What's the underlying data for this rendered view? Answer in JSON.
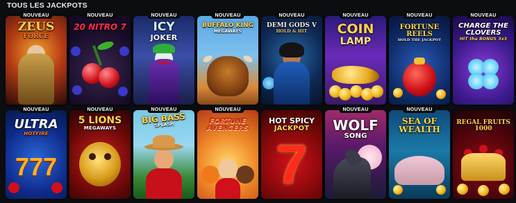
{
  "section": {
    "title": "TOUS LES JACKPOTS"
  },
  "colors": {
    "page_bg": "#0b0d10",
    "badge_bg": "#0a0b0d",
    "title_text": "#e9e9e9"
  },
  "games": [
    {
      "title": "ZEUS",
      "subtitle": "FORCE",
      "badge": "NOUVEAU"
    },
    {
      "title": "20 NITRO 7",
      "subtitle": "",
      "badge": "NOUVEAU"
    },
    {
      "title": "ICY",
      "subtitle": "JOKER",
      "badge": "NOUVEAU"
    },
    {
      "title": "BUFFALO KING",
      "subtitle": "MEGAWAYS",
      "badge": "NOUVEAU"
    },
    {
      "title": "DEMI GODS V",
      "subtitle": "HOLD & HIT",
      "badge": "NOUVEAU"
    },
    {
      "title": "COIN",
      "subtitle": "LAMP",
      "badge": "NOUVEAU"
    },
    {
      "title": "FORTUNE REELS",
      "subtitle": "HOLD THE JACKPOT",
      "badge": "NOUVEAU"
    },
    {
      "title": "CHARGE THE CLOVERS",
      "subtitle": "HIT the BONUS 3x3",
      "badge": "NOUVEAU"
    },
    {
      "title": "ULTRA",
      "subtitle": "HOTFIRE",
      "badge": "NOUVEAU"
    },
    {
      "title": "5 LIONS",
      "subtitle": "MEGAWAYS",
      "badge": "NOUVEAU"
    },
    {
      "title": "BIG BASS",
      "subtitle": "SPLASH",
      "badge": "NOUVEAU"
    },
    {
      "title": "FORTUNE AVENGERS",
      "subtitle": "",
      "badge": "NOUVEAU"
    },
    {
      "title": "HOT SPICY",
      "subtitle": "JACKPOT",
      "badge": ""
    },
    {
      "title": "WOLF",
      "subtitle": "SONG",
      "badge": "NOUVEAU"
    },
    {
      "title": "SEA OF WEALTH",
      "subtitle": "",
      "badge": "NOUVEAU"
    },
    {
      "title": "REGAL FRUITS 1000",
      "subtitle": "",
      "badge": ""
    }
  ]
}
